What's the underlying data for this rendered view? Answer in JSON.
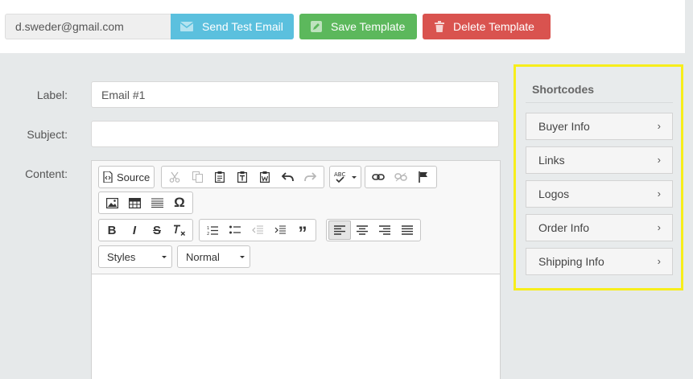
{
  "topbar": {
    "email_value": "d.sweder@gmail.com",
    "send_test_label": "Send Test Email",
    "save_label": "Save Template",
    "delete_label": "Delete Template"
  },
  "form": {
    "label_label": "Label:",
    "label_value": "Email #1",
    "subject_label": "Subject:",
    "subject_value": "",
    "content_label": "Content:"
  },
  "editor": {
    "source_label": "Source",
    "styles_label": "Styles",
    "format_label": "Normal"
  },
  "shortcodes": {
    "title": "Shortcodes",
    "items": [
      {
        "label": "Buyer Info"
      },
      {
        "label": "Links"
      },
      {
        "label": "Logos"
      },
      {
        "label": "Order Info"
      },
      {
        "label": "Shipping Info"
      }
    ]
  },
  "colors": {
    "info": "#5bc0de",
    "success": "#5cb85c",
    "danger": "#d9534f",
    "highlight": "#f7ee1b"
  }
}
